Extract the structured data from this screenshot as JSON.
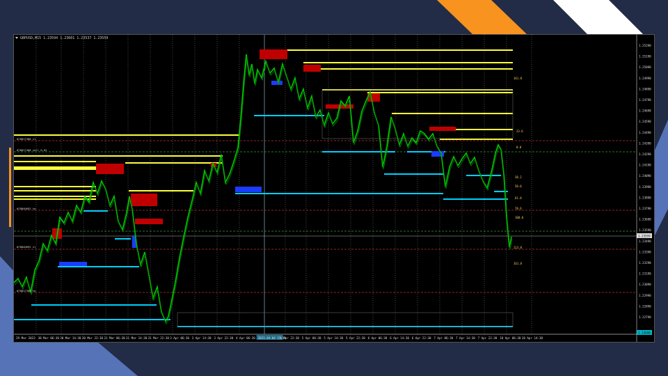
{
  "slide": {
    "colors": {
      "background": "#232c46",
      "orange": "#f7931e",
      "white": "#ffffff",
      "blue": "#5673b8"
    }
  },
  "chart": {
    "title": "GBPUSD,M15  1.23594 1.23601 1.23537 1.23559",
    "symbol_icon": "dropdown-triangle-icon",
    "price_axis_labels": [
      "1.25290",
      "1.25190",
      "1.25090",
      "1.24990",
      "1.24890",
      "1.24790",
      "1.24690",
      "1.24590",
      "1.24490",
      "1.24390",
      "1.24290",
      "1.24190",
      "1.24090",
      "1.23990",
      "1.23890",
      "1.23790",
      "1.23690",
      "1.23590",
      "1.23490",
      "1.23390",
      "1.23290",
      "1.23190",
      "1.23090",
      "1.22990",
      "1.22890",
      "1.22790"
    ],
    "current_price": "1.23559",
    "bottom_right_price": "1.22690",
    "time_axis_labels": [
      "29 Mar 2023",
      "30 Mar 06:30",
      "30 Mar 14:30",
      "30 Mar 22:30",
      "31 Mar 06:30",
      "31 Mar 14:30",
      "31 Mar 22:30",
      "3 Apr 06:30",
      "3 Apr 14:30",
      "3 Apr 22:30",
      "4 Apr 06:30",
      "2023.04.04 15:30",
      "4 Apr 22:30",
      "5 Apr 06:30",
      "5 Apr 14:30",
      "5 Apr 22:30",
      "6 Apr 06:30",
      "6 Apr 14:30",
      "6 Apr 22:30",
      "7 Apr 06:30",
      "7 Apr 14:30",
      "7 Apr 22:30",
      "10 Apr 06:30",
      "10 Apr 14:30"
    ],
    "left_labels": [
      "#78817308 sl",
      "#78817308 sell 0.02",
      "#78840692 tp",
      "#78840692 sl",
      "#78817308 tp"
    ],
    "fib_labels": [
      "161.8",
      "23.6",
      "0.0",
      "38.2",
      "50.0",
      "61.8",
      "78.6",
      "100.0",
      "113.0",
      "161.8"
    ],
    "colors": {
      "bullish": "#00c800",
      "bearish": "#00c800",
      "support": "#00cfff",
      "resistance": "#ffff3a",
      "supply_zone": "#c00000",
      "demand_zone": "#1a3cff",
      "grid": "#888888"
    }
  }
}
